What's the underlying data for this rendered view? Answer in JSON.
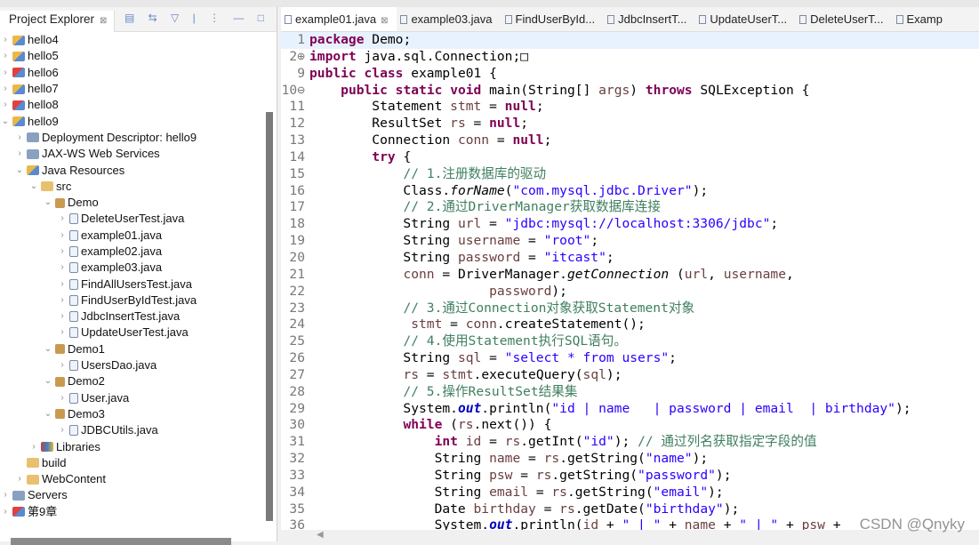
{
  "explorer": {
    "title": "Project Explorer",
    "close": "⊠",
    "tools": "▤ ⇆ ▽ | ⋮ — □"
  },
  "tree": [
    {
      "d": 0,
      "t": ">",
      "i": "proj",
      "label": "hello4"
    },
    {
      "d": 0,
      "t": ">",
      "i": "proj",
      "label": "hello5"
    },
    {
      "d": 0,
      "t": ">",
      "i": "projerr",
      "label": "hello6"
    },
    {
      "d": 0,
      "t": ">",
      "i": "proj",
      "label": "hello7"
    },
    {
      "d": 0,
      "t": ">",
      "i": "projerr",
      "label": "hello8"
    },
    {
      "d": 0,
      "t": "v",
      "i": "proj",
      "label": "hello9"
    },
    {
      "d": 1,
      "t": ">",
      "i": "misc",
      "label": "Deployment Descriptor: hello9"
    },
    {
      "d": 1,
      "t": ">",
      "i": "misc",
      "label": "JAX-WS Web Services"
    },
    {
      "d": 1,
      "t": "v",
      "i": "proj",
      "label": "Java Resources"
    },
    {
      "d": 2,
      "t": "v",
      "i": "folder",
      "label": "src"
    },
    {
      "d": 3,
      "t": "v",
      "i": "pkg",
      "label": "Demo"
    },
    {
      "d": 4,
      "t": ">",
      "i": "java",
      "label": "DeleteUserTest.java"
    },
    {
      "d": 4,
      "t": ">",
      "i": "java",
      "label": "example01.java"
    },
    {
      "d": 4,
      "t": ">",
      "i": "java",
      "label": "example02.java"
    },
    {
      "d": 4,
      "t": ">",
      "i": "java",
      "label": "example03.java"
    },
    {
      "d": 4,
      "t": ">",
      "i": "java",
      "label": "FindAllUsersTest.java"
    },
    {
      "d": 4,
      "t": ">",
      "i": "java",
      "label": "FindUserByIdTest.java"
    },
    {
      "d": 4,
      "t": ">",
      "i": "java",
      "label": "JdbcInsertTest.java"
    },
    {
      "d": 4,
      "t": ">",
      "i": "java",
      "label": "UpdateUserTest.java"
    },
    {
      "d": 3,
      "t": "v",
      "i": "pkg",
      "label": "Demo1"
    },
    {
      "d": 4,
      "t": ">",
      "i": "java",
      "label": "UsersDao.java"
    },
    {
      "d": 3,
      "t": "v",
      "i": "pkg",
      "label": "Demo2"
    },
    {
      "d": 4,
      "t": ">",
      "i": "java",
      "label": "User.java"
    },
    {
      "d": 3,
      "t": "v",
      "i": "pkg",
      "label": "Demo3"
    },
    {
      "d": 4,
      "t": ">",
      "i": "java",
      "label": "JDBCUtils.java"
    },
    {
      "d": 2,
      "t": ">",
      "i": "lib",
      "label": "Libraries"
    },
    {
      "d": 1,
      "t": "",
      "i": "folder",
      "label": "build"
    },
    {
      "d": 1,
      "t": ">",
      "i": "folder",
      "label": "WebContent"
    },
    {
      "d": 0,
      "t": ">",
      "i": "misc",
      "label": "Servers"
    },
    {
      "d": 0,
      "t": ">",
      "i": "projerr",
      "label": "第9章"
    }
  ],
  "tabs": [
    {
      "label": "example01.java",
      "active": true
    },
    {
      "label": "example03.java"
    },
    {
      "label": "FindUserById..."
    },
    {
      "label": "JdbcInsertT..."
    },
    {
      "label": "UpdateUserT..."
    },
    {
      "label": "DeleteUserT..."
    },
    {
      "label": "Examp"
    }
  ],
  "tab_close": "⊠",
  "code": [
    {
      "n": "1",
      "t": [
        [
          "k",
          "package"
        ],
        [
          "p",
          " Demo;"
        ]
      ]
    },
    {
      "n": "2⊕",
      "t": [
        [
          "k",
          "import"
        ],
        [
          "p",
          " java.sql.Connection;□"
        ]
      ]
    },
    {
      "n": "9",
      "t": [
        [
          "k",
          "public"
        ],
        [
          "p",
          " "
        ],
        [
          "k",
          "class"
        ],
        [
          "p",
          " example01 {"
        ]
      ]
    },
    {
      "n": "10⊖",
      "t": [
        [
          "p",
          "    "
        ],
        [
          "k",
          "public"
        ],
        [
          "p",
          " "
        ],
        [
          "k",
          "static"
        ],
        [
          "p",
          " "
        ],
        [
          "k",
          "void"
        ],
        [
          "p",
          " main(String[] "
        ],
        [
          "v",
          "args"
        ],
        [
          "p",
          ") "
        ],
        [
          "k",
          "throws"
        ],
        [
          "p",
          " SQLException {"
        ]
      ]
    },
    {
      "n": "11",
      "t": [
        [
          "p",
          "        Statement "
        ],
        [
          "v",
          "stmt"
        ],
        [
          "p",
          " = "
        ],
        [
          "k",
          "null"
        ],
        [
          "p",
          ";"
        ]
      ]
    },
    {
      "n": "12",
      "t": [
        [
          "p",
          "        ResultSet "
        ],
        [
          "v",
          "rs"
        ],
        [
          "p",
          " = "
        ],
        [
          "k",
          "null"
        ],
        [
          "p",
          ";"
        ]
      ]
    },
    {
      "n": "13",
      "t": [
        [
          "p",
          "        Connection "
        ],
        [
          "v",
          "conn"
        ],
        [
          "p",
          " = "
        ],
        [
          "k",
          "null"
        ],
        [
          "p",
          ";"
        ]
      ]
    },
    {
      "n": "14",
      "t": [
        [
          "p",
          "        "
        ],
        [
          "k",
          "try"
        ],
        [
          "p",
          " {"
        ]
      ]
    },
    {
      "n": "15",
      "t": [
        [
          "p",
          "            "
        ],
        [
          "c",
          "// 1.注册数据库的驱动"
        ]
      ]
    },
    {
      "n": "16",
      "t": [
        [
          "p",
          "            Class."
        ],
        [
          "m",
          "forName"
        ],
        [
          "p",
          "("
        ],
        [
          "s",
          "\"com.mysql.jdbc.Driver\""
        ],
        [
          "p",
          ");"
        ]
      ]
    },
    {
      "n": "17",
      "t": [
        [
          "p",
          "            "
        ],
        [
          "c",
          "// 2.通过DriverManager获取数据库连接"
        ]
      ]
    },
    {
      "n": "18",
      "t": [
        [
          "p",
          "            String "
        ],
        [
          "v",
          "url"
        ],
        [
          "p",
          " = "
        ],
        [
          "s",
          "\"jdbc:mysql://localhost:3306/jdbc\""
        ],
        [
          "p",
          ";"
        ]
      ]
    },
    {
      "n": "19",
      "t": [
        [
          "p",
          "            String "
        ],
        [
          "v",
          "username"
        ],
        [
          "p",
          " = "
        ],
        [
          "s",
          "\"root\""
        ],
        [
          "p",
          ";"
        ]
      ]
    },
    {
      "n": "20",
      "t": [
        [
          "p",
          "            String "
        ],
        [
          "v",
          "password"
        ],
        [
          "p",
          " = "
        ],
        [
          "s",
          "\"itcast\""
        ],
        [
          "p",
          ";"
        ]
      ]
    },
    {
      "n": "21",
      "t": [
        [
          "p",
          "            "
        ],
        [
          "v",
          "conn"
        ],
        [
          "p",
          " = DriverManager."
        ],
        [
          "m",
          "getConnection"
        ],
        [
          "p",
          " ("
        ],
        [
          "v",
          "url"
        ],
        [
          "p",
          ", "
        ],
        [
          "v",
          "username"
        ],
        [
          "p",
          ","
        ]
      ]
    },
    {
      "n": "22",
      "t": [
        [
          "p",
          "                       "
        ],
        [
          "v",
          "password"
        ],
        [
          "p",
          ");"
        ]
      ]
    },
    {
      "n": "23",
      "t": [
        [
          "p",
          "            "
        ],
        [
          "c",
          "// 3.通过Connection对象获取Statement对象"
        ]
      ]
    },
    {
      "n": "24",
      "t": [
        [
          "p",
          "             "
        ],
        [
          "v",
          "stmt"
        ],
        [
          "p",
          " = "
        ],
        [
          "v",
          "conn"
        ],
        [
          "p",
          ".createStatement();"
        ]
      ]
    },
    {
      "n": "25",
      "t": [
        [
          "p",
          "            "
        ],
        [
          "c",
          "// 4.使用Statement执行SQL语句。"
        ]
      ]
    },
    {
      "n": "26",
      "t": [
        [
          "p",
          "            String "
        ],
        [
          "v",
          "sql"
        ],
        [
          "p",
          " = "
        ],
        [
          "s",
          "\"select * from users\""
        ],
        [
          "p",
          ";"
        ]
      ]
    },
    {
      "n": "27",
      "t": [
        [
          "p",
          "            "
        ],
        [
          "v",
          "rs"
        ],
        [
          "p",
          " = "
        ],
        [
          "v",
          "stmt"
        ],
        [
          "p",
          ".executeQuery("
        ],
        [
          "v",
          "sql"
        ],
        [
          "p",
          ");"
        ]
      ]
    },
    {
      "n": "28",
      "t": [
        [
          "p",
          "            "
        ],
        [
          "c",
          "// 5.操作ResultSet结果集"
        ]
      ]
    },
    {
      "n": "29",
      "t": [
        [
          "p",
          "            System."
        ],
        [
          "f",
          "out"
        ],
        [
          "p",
          ".println("
        ],
        [
          "s",
          "\"id | name   | password | email  | birthday\""
        ],
        [
          "p",
          ");"
        ]
      ]
    },
    {
      "n": "30",
      "t": [
        [
          "p",
          "            "
        ],
        [
          "k",
          "while"
        ],
        [
          "p",
          " ("
        ],
        [
          "v",
          "rs"
        ],
        [
          "p",
          ".next()) {"
        ]
      ]
    },
    {
      "n": "31",
      "t": [
        [
          "p",
          "                "
        ],
        [
          "k",
          "int"
        ],
        [
          "p",
          " "
        ],
        [
          "v",
          "id"
        ],
        [
          "p",
          " = "
        ],
        [
          "v",
          "rs"
        ],
        [
          "p",
          ".getInt("
        ],
        [
          "s",
          "\"id\""
        ],
        [
          "p",
          "); "
        ],
        [
          "c",
          "// 通过列名获取指定字段的值"
        ]
      ]
    },
    {
      "n": "32",
      "t": [
        [
          "p",
          "                String "
        ],
        [
          "v",
          "name"
        ],
        [
          "p",
          " = "
        ],
        [
          "v",
          "rs"
        ],
        [
          "p",
          ".getString("
        ],
        [
          "s",
          "\"name\""
        ],
        [
          "p",
          ");"
        ]
      ]
    },
    {
      "n": "33",
      "t": [
        [
          "p",
          "                String "
        ],
        [
          "v",
          "psw"
        ],
        [
          "p",
          " = "
        ],
        [
          "v",
          "rs"
        ],
        [
          "p",
          ".getString("
        ],
        [
          "s",
          "\"password\""
        ],
        [
          "p",
          ");"
        ]
      ]
    },
    {
      "n": "34",
      "t": [
        [
          "p",
          "                String "
        ],
        [
          "v",
          "email"
        ],
        [
          "p",
          " = "
        ],
        [
          "v",
          "rs"
        ],
        [
          "p",
          ".getString("
        ],
        [
          "s",
          "\"email\""
        ],
        [
          "p",
          ");"
        ]
      ]
    },
    {
      "n": "35",
      "t": [
        [
          "p",
          "                Date "
        ],
        [
          "v",
          "birthday"
        ],
        [
          "p",
          " = "
        ],
        [
          "v",
          "rs"
        ],
        [
          "p",
          ".getDate("
        ],
        [
          "s",
          "\"birthday\""
        ],
        [
          "p",
          ");"
        ]
      ]
    },
    {
      "n": "36",
      "t": [
        [
          "p",
          "                System."
        ],
        [
          "f",
          "out"
        ],
        [
          "p",
          ".println("
        ],
        [
          "v",
          "id"
        ],
        [
          "p",
          " + "
        ],
        [
          "s",
          "\" | \""
        ],
        [
          "p",
          " + "
        ],
        [
          "v",
          "name"
        ],
        [
          "p",
          " + "
        ],
        [
          "s",
          "\" | \""
        ],
        [
          "p",
          " + "
        ],
        [
          "v",
          "psw"
        ],
        [
          "p",
          " + "
        ]
      ]
    }
  ],
  "watermark": "CSDN @Qnyky",
  "colors": {
    "keyword": "#7f0055",
    "string": "#2a00ff",
    "comment": "#3f7f5f",
    "local_var": "#6a3e3e",
    "field": "#0000c0",
    "current_line": "#e8f2fe"
  }
}
